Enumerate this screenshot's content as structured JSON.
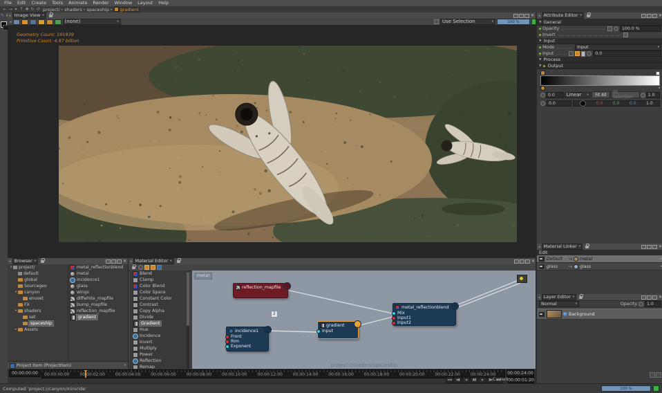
{
  "glyphs": {
    "dropdown": "▾",
    "collapse": "◂",
    "down": "▼",
    "right": "▸",
    "close": "✕",
    "sep": "▸",
    "tree_open": "▾",
    "tree_closed": "▸",
    "redirect": "↪"
  },
  "menu": {
    "items": [
      "File",
      "Edit",
      "Create",
      "Tools",
      "Animate",
      "Render",
      "Window",
      "Layout",
      "Help"
    ]
  },
  "nav_icons": [
    {
      "name": "back-icon",
      "glyph": "←"
    },
    {
      "name": "forward-icon",
      "glyph": "→"
    },
    {
      "name": "history-icon",
      "glyph": "▾"
    },
    {
      "name": "up-icon",
      "glyph": "↑"
    },
    {
      "name": "add-context-icon",
      "glyph": "✚"
    },
    {
      "name": "reload-icon",
      "glyph": "↻"
    },
    {
      "name": "undo-icon",
      "glyph": "↺"
    }
  ],
  "breadcrumb": {
    "segments": [
      "project/",
      "shaders",
      "spaceship"
    ],
    "current": "gradient"
  },
  "left_toolbar": {
    "tools": [
      {
        "name": "select-tool-icon",
        "glyph": "✎",
        "color": "#7d93ad"
      },
      {
        "name": "translate-tool-icon",
        "glyph": "➤",
        "color": "#c08a3e"
      },
      {
        "name": "rotate-tool-icon",
        "glyph": "↻",
        "color": "#7d93ad"
      },
      {
        "name": "scale-tool-icon",
        "glyph": "✐",
        "color": "#c08a3e"
      },
      {
        "name": "snap-tool-icon",
        "glyph": "✦",
        "color": "#8a8a8a"
      },
      {
        "name": "pivot-tool-icon",
        "glyph": "✥",
        "color": "#7d93ad"
      },
      {
        "name": "paint-tool-icon",
        "glyph": "✎",
        "color": "#c08a3e"
      },
      {
        "name": "measure-tool-icon",
        "glyph": "▲",
        "color": "#7d93ad"
      },
      {
        "name": "camera-tool-icon",
        "glyph": "➶",
        "color": "#c08a3e"
      },
      {
        "name": "light-tool-icon",
        "glyph": "✱",
        "color": "#7d93ad"
      },
      {
        "name": "material-tool-icon",
        "glyph": "◧",
        "color": "#8fa0b5"
      },
      {
        "name": "gradient-tool-icon",
        "glyph": "▨",
        "color": "#2a2a2a",
        "active": true
      },
      {
        "name": "picker-tool-icon",
        "glyph": "⧉",
        "color": "#7d93ad"
      }
    ]
  },
  "image_view": {
    "title": "Image View",
    "toolbar_icons": [
      {
        "name": "compare-icon",
        "color": "#6d86a8"
      },
      {
        "name": "save-image-icon",
        "color": "#d98e2b"
      },
      {
        "name": "region-icon",
        "color": "#56759a"
      },
      {
        "name": "exposure-icon",
        "color": "#d9a02b"
      },
      {
        "name": "lut-icon",
        "color": "#c8872a"
      },
      {
        "name": "channels-icon",
        "color": "#4aa24a"
      }
    ],
    "layer_select": "(none)",
    "use_selection": "Use Selection",
    "progress": "100 %",
    "overlay": [
      "Geometry Count: 191939",
      "Primitive Count: 4.97 billion"
    ]
  },
  "attribute_editor": {
    "title": "Attribute Editor",
    "sections": {
      "general": "General",
      "input": "Input",
      "process": "Process",
      "output": "Output"
    },
    "opacity_label": "Opacity",
    "opacity_value": "100.0 %",
    "invert_label": "Invert",
    "mode_label": "Mode",
    "mode_value": "Input",
    "input_label": "Input",
    "input_value": "0.0",
    "output": {
      "min": "0.0",
      "interp": "Linear",
      "fit_all": "Fit All",
      "fit_selection": "Fit Selection",
      "max": "1.0",
      "pos": "0.0",
      "r": "0.0",
      "g": "0.0",
      "b": "0.0",
      "a": "1.0"
    }
  },
  "material_linker": {
    "title": "Material Linker",
    "edit_label": "Edit",
    "rows": [
      {
        "name": "Default",
        "material": "metal",
        "ball": "#a5875f",
        "selected": true
      },
      {
        "name": "glass",
        "material": "glass",
        "ball": "#9ab4c4",
        "selected": false
      }
    ]
  },
  "layer_editor": {
    "title": "Layer Editor",
    "blend_mode": "Normal",
    "opacity_label": "Opacity",
    "opacity_value": "1.0",
    "layers": [
      {
        "name": "Background"
      }
    ]
  },
  "browser": {
    "title": "Browser",
    "tree": [
      {
        "label": "project/",
        "depth": 0,
        "state": "open",
        "icon": "root"
      },
      {
        "label": "default",
        "depth": 1,
        "state": "leaf",
        "icon": "root"
      },
      {
        "label": "global",
        "depth": 1,
        "state": "leaf",
        "icon": "folder"
      },
      {
        "label": "Sourcegeo",
        "depth": 1,
        "state": "leaf",
        "icon": "folder"
      },
      {
        "label": "canyon",
        "depth": 1,
        "state": "open",
        "icon": "folder"
      },
      {
        "label": "envset",
        "depth": 2,
        "state": "leaf",
        "icon": "folder"
      },
      {
        "label": "FX",
        "depth": 1,
        "state": "leaf",
        "icon": "folder"
      },
      {
        "label": "shaders",
        "depth": 1,
        "state": "open",
        "icon": "folder"
      },
      {
        "label": "set",
        "depth": 2,
        "state": "leaf",
        "icon": "folder"
      },
      {
        "label": "spaceship",
        "depth": 2,
        "state": "leaf",
        "icon": "folder",
        "selected": true
      },
      {
        "label": "Assets",
        "depth": 1,
        "state": "closed",
        "icon": "folder"
      }
    ],
    "items": [
      {
        "label": "metal_reflectionblend",
        "icon": "blend"
      },
      {
        "label": "metal",
        "icon": "material"
      },
      {
        "label": "incidence1",
        "icon": "incidence"
      },
      {
        "label": "glass",
        "icon": "material"
      },
      {
        "label": "wings",
        "icon": "material"
      },
      {
        "label": "diffwhite_mapfile",
        "icon": "texture"
      },
      {
        "label": "bump_mapfile",
        "icon": "texture"
      },
      {
        "label": "reflection_mapfile",
        "icon": "texture"
      },
      {
        "label": "gradient",
        "icon": "gradient",
        "selected": true
      }
    ],
    "filter_label": "Project Item (ProjectItem)"
  },
  "material_editor": {
    "title": "Material Editor",
    "node_types": [
      {
        "label": "Blend",
        "icon": "blend"
      },
      {
        "label": "Clamp",
        "icon": "fx"
      },
      {
        "label": "Color Blend",
        "icon": "blend"
      },
      {
        "label": "Color Space",
        "icon": "fx"
      },
      {
        "label": "Constant Color",
        "icon": "fx"
      },
      {
        "label": "Contrast",
        "icon": "fx"
      },
      {
        "label": "Copy Alpha",
        "icon": "fx"
      },
      {
        "label": "Divide",
        "icon": "fx"
      },
      {
        "label": "Gradient",
        "icon": "gradient",
        "selected": true
      },
      {
        "label": "Hue",
        "icon": "fx"
      },
      {
        "label": "Incidence",
        "icon": "incidence"
      },
      {
        "label": "Invert",
        "icon": "fx"
      },
      {
        "label": "Multiply",
        "icon": "fx"
      },
      {
        "label": "Power",
        "icon": "fx"
      },
      {
        "label": "Reflection",
        "icon": "incidence"
      },
      {
        "label": "Remap",
        "icon": "fx"
      }
    ],
    "graph": {
      "context": "metal",
      "wire_label": "2",
      "watermark": "project://shaders/spaceship",
      "nodes": [
        {
          "name": "reflection_mapfile",
          "icon": "texture",
          "body": "#6e1b26",
          "border": "#49121a",
          "out": "#5d1620",
          "ports": []
        },
        {
          "name": "incidence1",
          "icon": "incidence",
          "body": "#1d3a55",
          "border": "#132a40",
          "out": "#16334d",
          "ports": [
            {
              "label": "Front",
              "color": "#e23030"
            },
            {
              "label": "Rim",
              "color": "#e23030"
            },
            {
              "label": "Exponent",
              "color": "#35d6e0"
            }
          ]
        },
        {
          "name": "gradient",
          "icon": "gradient",
          "body": "#1d3a55",
          "border": "#e8a23c",
          "out": "#e8a23c",
          "selected": true,
          "ports": [
            {
              "label": "Input",
              "color": "#35d6e0"
            }
          ]
        },
        {
          "name": "metal_reflectionblend",
          "icon": "blend",
          "body": "#1d3a55",
          "border": "#132a40",
          "out": "#16334d",
          "ports": [
            {
              "label": "Mix",
              "color": "#35d6e0"
            },
            {
              "label": "Input1",
              "color": "#e23030"
            },
            {
              "label": "Input2",
              "color": "#e23030"
            }
          ]
        }
      ]
    }
  },
  "timeline": {
    "start": "00:00:00:00",
    "end": "00:00:24:00",
    "ticks": [
      "00:00:00:00",
      "00:00:02:00",
      "00:00:04:00",
      "00:00:06:00",
      "00:00:08:00",
      "00:00:10:00",
      "00:00:12:00",
      "00:00:14:00",
      "00:00:16:00",
      "00:00:18:00",
      "00:00:20:00",
      "00:00:22:00",
      "00:00:24:00"
    ],
    "transport": [
      "◄◄",
      "◄▮",
      "◄",
      "▮▮",
      "►",
      "▮►",
      "►►"
    ],
    "current_label": "Current",
    "current_value": "00:00:01:20"
  },
  "status": {
    "message": "Computed 'project://canyon/miniride'",
    "progress": "100 %"
  }
}
